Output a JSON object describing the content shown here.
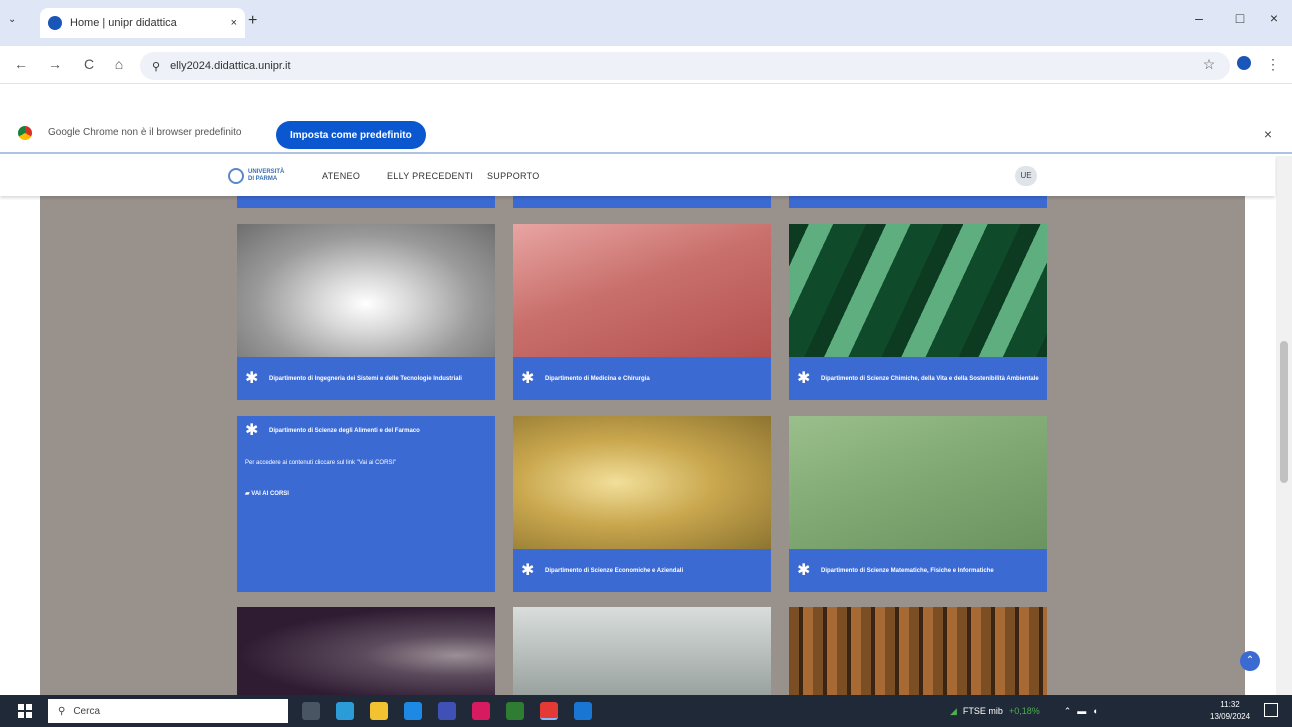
{
  "browser": {
    "tab_title": "Home | unipr didattica",
    "url": "elly2024.didattica.unipr.it",
    "new_tab": "+",
    "minimize": "–",
    "maximize": "□",
    "close": "×",
    "back": "←",
    "forward": "→",
    "reload": "C",
    "site_info": "⚲",
    "zoom": "🔍",
    "star": "☆",
    "menu": "⋮"
  },
  "default_bar": {
    "message": "Google Chrome non è il browser predefinito",
    "button": "Imposta come predefinito",
    "close": "×"
  },
  "header": {
    "logo_line1": "UNIVERSITÀ",
    "logo_line2": "DI PARMA",
    "nav": [
      "ATENEO",
      "ELLY PRECEDENTI",
      "SUPPORTO"
    ],
    "user": "UE"
  },
  "cards": [
    {
      "title": "Dipartimento di Ingegneria dei Sistemi e delle Tecnologie Industriali"
    },
    {
      "title": "Dipartimento di Medicina e Chirurgia"
    },
    {
      "title": "Dipartimento di Scienze Chimiche, della Vita e della Sostenibilità Ambientale"
    },
    {
      "title": "Dipartimento di Scienze degli Alimenti e del Farmaco",
      "body": "Per accedere ai contenuti cliccare sul link \"Vai ai CORSI\"",
      "link": "VAI AI CORSI"
    },
    {
      "title": "Dipartimento di Scienze Economiche e Aziendali"
    },
    {
      "title": "Dipartimento di Scienze Matematiche, Fisiche e Informatiche"
    }
  ],
  "taskbar": {
    "search": "Cerca",
    "ticker": "FTSE mib",
    "ticker_value": "+0,18%",
    "time": "11:32",
    "date": "13/09/2024"
  },
  "colors": {
    "card_blue": "#3c6ad3",
    "content_bg": "#99918c",
    "accent": "#0b57d0"
  }
}
